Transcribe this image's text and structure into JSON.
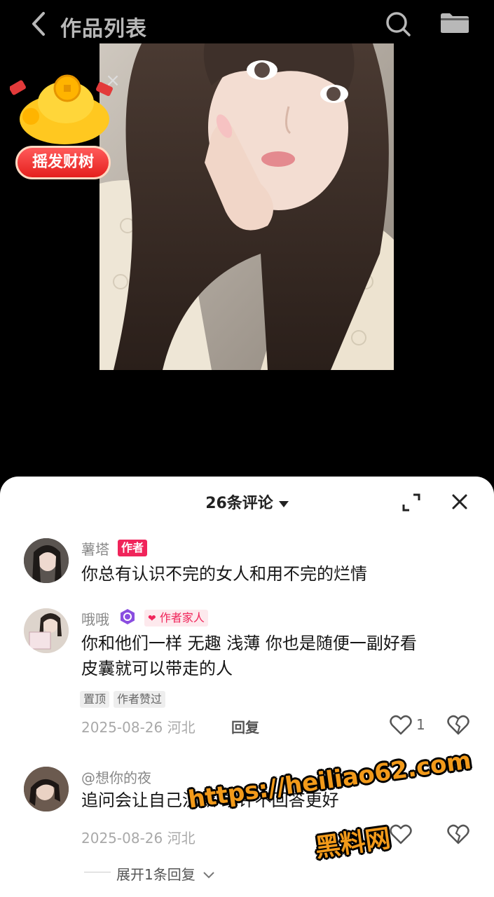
{
  "header": {
    "title": "作品列表",
    "back_icon": "chevron-left-icon",
    "search_icon": "search-icon",
    "more_icon": "folder-icon"
  },
  "promo": {
    "label": "摇发财树",
    "close_glyph": "×"
  },
  "comments_panel": {
    "count_label": "26条评论",
    "expand_icon": "expand-icon",
    "close_icon": "close-icon",
    "comments": [
      {
        "user": "薯塔",
        "badge": "作者",
        "text": "你总有认识不完的女人和用不完的烂情"
      },
      {
        "user": "哦哦",
        "badge": "作者家人",
        "text_line1": "你和他们一样 无趣 浅薄 你也是随便一副好看",
        "text_line2": "皮囊就可以带走的人",
        "tags": [
          "置顶",
          "作者赞过"
        ],
        "date": "2025-08-26 河北",
        "reply_label": "回复",
        "like_count": "1"
      },
      {
        "user": "@想你的夜",
        "text": "追问会让自己沉默 或许不回答更好",
        "date": "2025-08-26 河北",
        "expand_replies": "展开1条回复"
      }
    ]
  },
  "watermark": {
    "line1": "https://heiliao62.com",
    "line2": "黑料网"
  },
  "colors": {
    "author_badge": "#f0245a",
    "accent_purple": "#8a4de0"
  }
}
